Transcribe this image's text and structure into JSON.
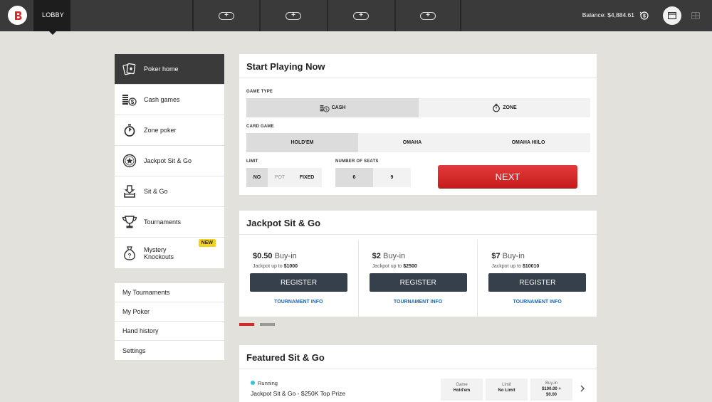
{
  "topbar": {
    "lobby_label": "LOBBY",
    "table_slots": [
      "+",
      "+",
      "+",
      "+"
    ],
    "balance": "Balance: $4,884.61"
  },
  "sidebar": {
    "items": [
      {
        "label": "Poker home",
        "icon": "cards-icon"
      },
      {
        "label": "Cash games",
        "icon": "coins-icon"
      },
      {
        "label": "Zone poker",
        "icon": "stopwatch-icon"
      },
      {
        "label": "Jackpot Sit & Go",
        "icon": "jackpot-icon"
      },
      {
        "label": "Sit & Go",
        "icon": "sit-go-icon"
      },
      {
        "label": "Tournaments",
        "icon": "trophy-icon"
      },
      {
        "label": "Mystery Knockouts",
        "icon": "money-bag-icon",
        "badge": "NEW"
      }
    ],
    "links": [
      "My Tournaments",
      "My Poker",
      "Hand history",
      "Settings"
    ]
  },
  "start": {
    "title": "Start Playing Now",
    "game_type_label": "GAME TYPE",
    "game_types": [
      "CASH",
      "ZONE"
    ],
    "card_game_label": "CARD GAME",
    "card_games": [
      "HOLD'EM",
      "OMAHA",
      "OMAHA HI/LO"
    ],
    "limit_label": "LIMIT",
    "limits": [
      "NO",
      "POT",
      "FIXED"
    ],
    "seats_label": "NUMBER OF SEATS",
    "seats": [
      "6",
      "9"
    ],
    "next_label": "NEXT"
  },
  "jackpot": {
    "title": "Jackpot Sit & Go",
    "cards": [
      {
        "price": "$0.50",
        "buyin": "Buy-in",
        "jackpot_prefix": "Jackpot up to",
        "jackpot": "$1000",
        "register": "REGISTER",
        "info": "TOURNAMENT INFO"
      },
      {
        "price": "$2",
        "buyin": "Buy-in",
        "jackpot_prefix": "Jackpot up to",
        "jackpot": "$2500",
        "register": "REGISTER",
        "info": "TOURNAMENT INFO"
      },
      {
        "price": "$7",
        "buyin": "Buy-in",
        "jackpot_prefix": "Jackpot up to",
        "jackpot": "$10010",
        "register": "REGISTER",
        "info": "TOURNAMENT INFO"
      }
    ]
  },
  "featured": {
    "title": "Featured Sit & Go",
    "status": "Running",
    "name": "Jackpot Sit & Go - $250K Top Prize",
    "game_label": "Game",
    "game_value": "Hold'em",
    "limit_label": "Limit",
    "limit_value": "No Limit",
    "buyin_label": "Buy-in",
    "buyin_value_1": "$100.00 +",
    "buyin_value_2": "$0.00"
  },
  "colors": {
    "topbar": "#3a3a3a",
    "accent_red": "#d42a2a",
    "register_button": "#35404c",
    "link_blue": "#1b6ab8",
    "badge_yellow": "#f4d21a",
    "running_dot": "#33c6d9"
  }
}
